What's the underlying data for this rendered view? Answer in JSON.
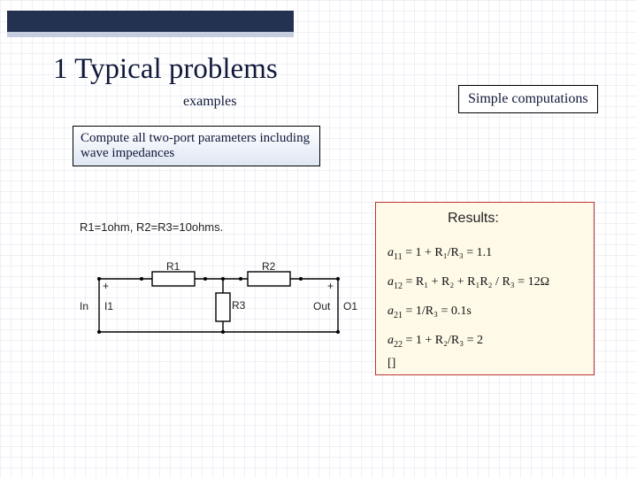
{
  "header": {
    "title": "1 Typical problems",
    "subtitle": "examples",
    "simple_box": "Simple computations"
  },
  "task": {
    "text": "Compute all two-port parameters including wave impedances"
  },
  "circuit": {
    "caption": "R1=1ohm, R2=R3=10ohms.",
    "r1": "R1",
    "r2": "R2",
    "r3": "R3",
    "in_port": "In",
    "in_label": "I1",
    "out_port": "Out",
    "out_label": "O1",
    "plus_left": "+",
    "plus_right": "+"
  },
  "results": {
    "title": "Results:",
    "eq1_lhs_sub": "11",
    "eq1_rhs": " = 1 + R₁/R₃ = 1.1",
    "eq2_lhs_sub": "12",
    "eq2_rhs": " = R₁ + R₂ + R₁R₂ / R₃ = 12Ω",
    "eq3_lhs_sub": "21",
    "eq3_rhs": " = 1/R₃ = 0.1s",
    "eq4_lhs_sub": "22",
    "eq4_rhs": " = 1 + R₂/R₃ = 2"
  }
}
